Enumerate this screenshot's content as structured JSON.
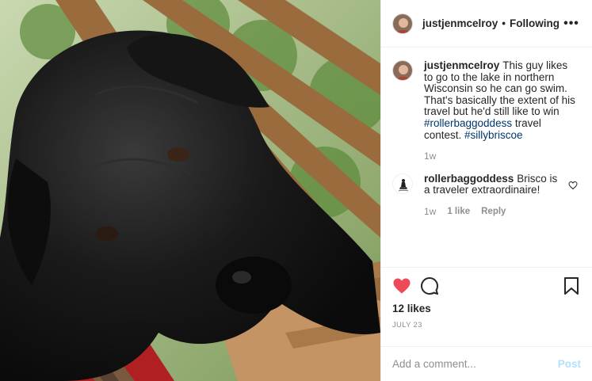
{
  "post": {
    "username": "justjenmcelroy",
    "separator": "•",
    "follow_status": "Following",
    "more_label": "•••"
  },
  "caption": {
    "username": "justjenmcelroy",
    "text": "This guy likes to go to the lake in northern Wisconsin so he can go swim. That's basically the extent of his travel but he'd still like to win ",
    "tag1": "#rollerbaggoddess",
    "text_after": " travel contest. ",
    "tag2": "#sillybriscoe",
    "time": "1w"
  },
  "comment": {
    "username": "rollerbaggoddess",
    "text": "Brisco is a traveler extraordinaire!",
    "time": "1w",
    "likes": "1 like",
    "reply": "Reply"
  },
  "actions": {
    "likes": "12 likes",
    "date": "July 23",
    "like_color": "#ed4956"
  },
  "composer": {
    "placeholder": "Add a comment...",
    "post_label": "Post"
  },
  "icons": {
    "like": "heart-filled-icon",
    "comment": "comment-bubble-icon",
    "save": "bookmark-icon",
    "comment_like": "heart-outline-icon"
  }
}
